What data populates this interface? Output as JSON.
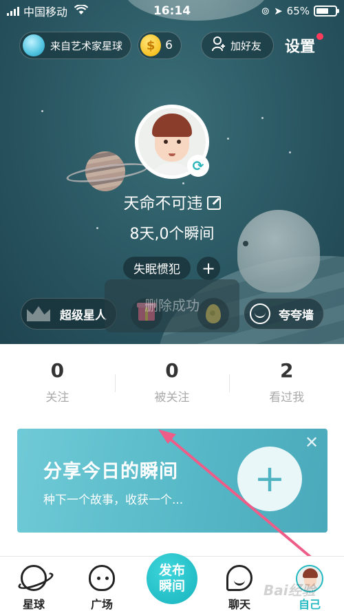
{
  "status_bar": {
    "carrier": "中国移动",
    "time": "16:14",
    "battery": "65%",
    "battery_level": 0.65
  },
  "header": {
    "origin_label": "来自艺术家星球",
    "coin_count": "6",
    "add_friend_label": "加好友",
    "settings_label": "设置"
  },
  "profile": {
    "username": "天命不可违",
    "stats_line": "8天,0个瞬间",
    "tag": "失眠惯犯",
    "tag_add": "+"
  },
  "features": {
    "superstar_label": "超级星人",
    "praise_wall_label": "夸夸墙"
  },
  "toast": {
    "message": "删除成功"
  },
  "counts": [
    {
      "value": "0",
      "label": "关注"
    },
    {
      "value": "0",
      "label": "被关注"
    },
    {
      "value": "2",
      "label": "看过我"
    }
  ],
  "share": {
    "title": "分享今日的瞬间",
    "subtitle": "种下一个故事，收获一个...",
    "plus": "+",
    "close": "✕"
  },
  "tabbar": {
    "planet": "星球",
    "plaza": "广场",
    "publish_line1": "发布",
    "publish_line2": "瞬间",
    "chat": "聊天",
    "me": "自己"
  },
  "watermark": "Bai经验",
  "colors": {
    "accent": "#22b9c2",
    "hero_bg": "#2c5a65",
    "share_bg": "#55b7c6",
    "arrow": "#ee5c88"
  }
}
